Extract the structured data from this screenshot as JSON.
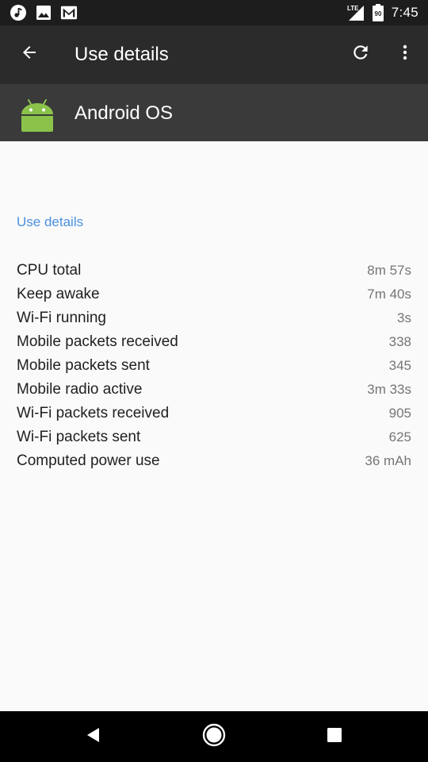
{
  "status_bar": {
    "time": "7:45",
    "network": "LTE",
    "battery": "90",
    "left_icons": [
      "music-note-icon",
      "image-icon",
      "gmail-icon"
    ],
    "right_icons": [
      "lte-signal-icon",
      "battery-icon"
    ]
  },
  "app_bar": {
    "title": "Use details",
    "icons": [
      "back-arrow-icon",
      "refresh-icon",
      "overflow-menu-icon"
    ]
  },
  "app_header": {
    "name": "Android OS",
    "icon": "android-robot-icon",
    "icon_color": "#8bc34a"
  },
  "section": {
    "title": "Use details",
    "accent_color": "#4a90e2"
  },
  "details": [
    {
      "label": "CPU total",
      "value": "8m 57s"
    },
    {
      "label": "Keep awake",
      "value": "7m 40s"
    },
    {
      "label": "Wi-Fi running",
      "value": "3s"
    },
    {
      "label": "Mobile packets received",
      "value": "338"
    },
    {
      "label": "Mobile packets sent",
      "value": "345"
    },
    {
      "label": "Mobile radio active",
      "value": "3m 33s"
    },
    {
      "label": "Wi-Fi packets received",
      "value": "905"
    },
    {
      "label": "Wi-Fi packets sent",
      "value": "625"
    },
    {
      "label": "Computed power use",
      "value": "36 mAh"
    }
  ],
  "nav_bar": {
    "icons": [
      "nav-back-icon",
      "nav-home-icon",
      "nav-recents-icon"
    ]
  }
}
